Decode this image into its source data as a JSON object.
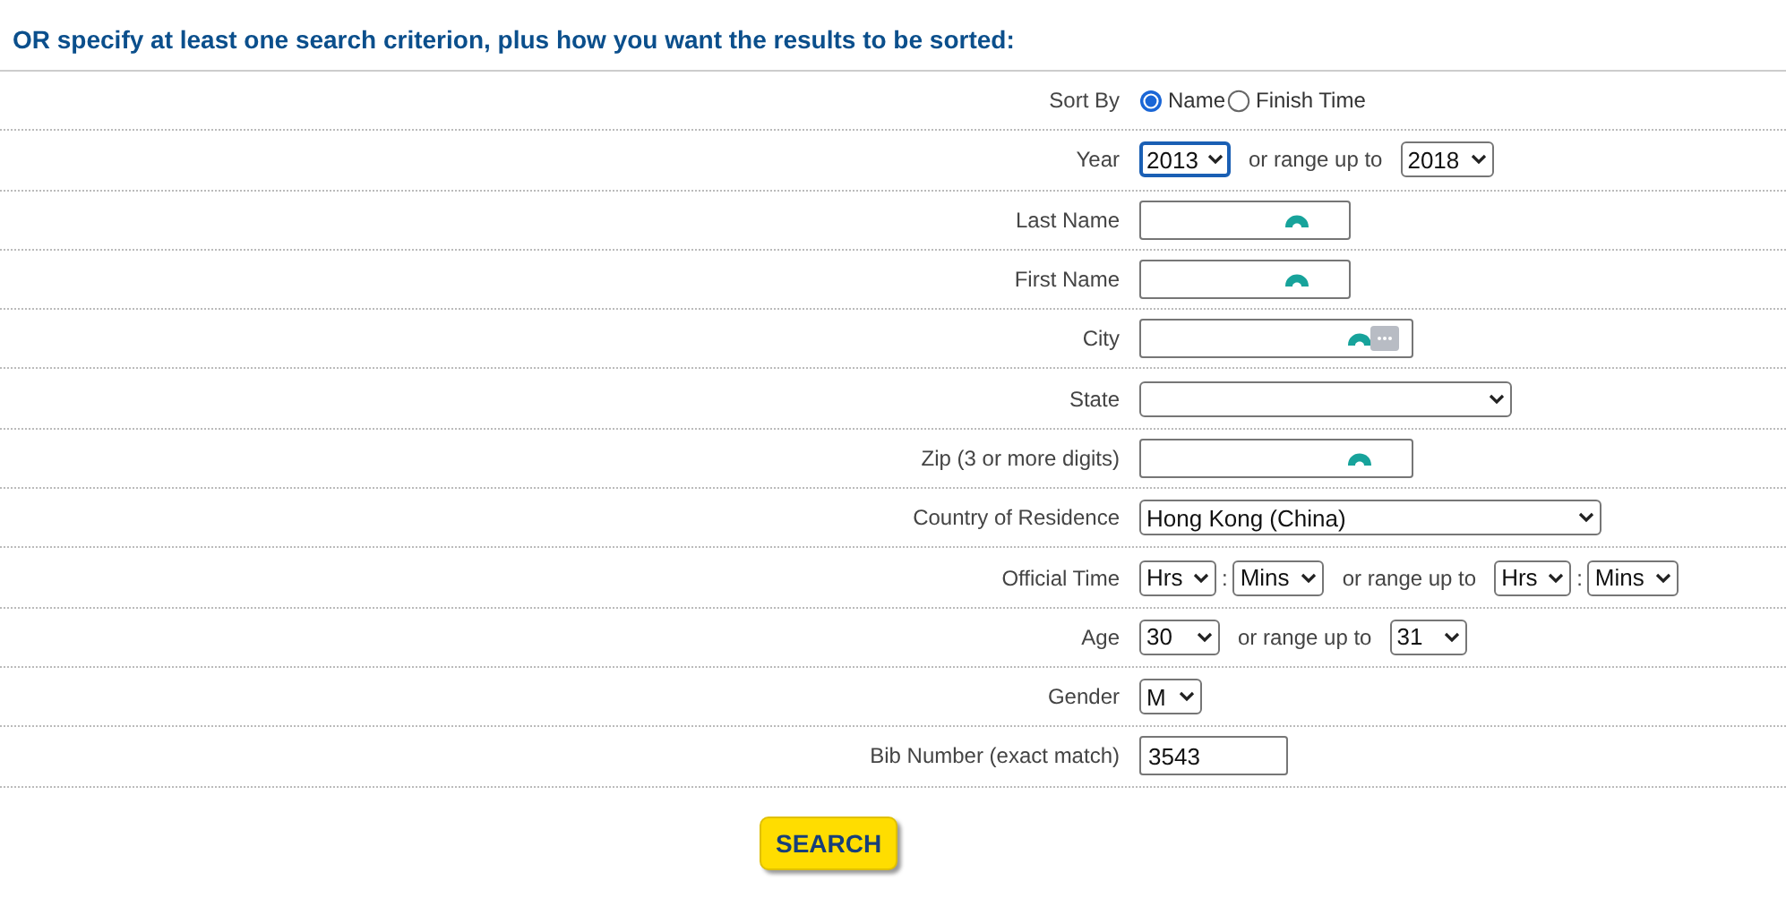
{
  "heading": "OR specify at least one search criterion, plus how you want the results to be sorted:",
  "rows": [
    {
      "kind": "radio",
      "label": "Sort By",
      "options": [
        {
          "label": "Name",
          "selected": true
        },
        {
          "label": "Finish Time",
          "selected": false
        }
      ]
    },
    {
      "kind": "range",
      "label": "Year",
      "from": {
        "value": "2013",
        "focused": true
      },
      "joiner": "or range up to",
      "to": {
        "value": "2018",
        "focused": false
      }
    },
    {
      "kind": "text",
      "label": "Last Name",
      "helper_icon": true,
      "menu_icon": false
    },
    {
      "kind": "text",
      "label": "First Name",
      "helper_icon": true,
      "menu_icon": false
    },
    {
      "kind": "text",
      "label": "City",
      "helper_icon": true,
      "menu_icon": true
    },
    {
      "kind": "select",
      "label": "State"
    },
    {
      "kind": "text",
      "label": "Zip (3 or more digits)",
      "helper_icon": true,
      "menu_icon": false
    },
    {
      "kind": "select",
      "label": "Country of Residence",
      "value": "Hong Kong (China)"
    },
    {
      "kind": "time",
      "label": "Official Time",
      "from": {
        "hours": "Hrs",
        "separator": ":",
        "minutes": "Mins"
      },
      "joiner": "or range up to",
      "to": {
        "hours": "Hrs",
        "separator": ":",
        "minutes": "Mins"
      }
    },
    {
      "kind": "range",
      "label": "Age",
      "from": {
        "value": "30",
        "focused": false
      },
      "joiner": "or range up to",
      "to": {
        "value": "31",
        "focused": false
      }
    },
    {
      "kind": "select",
      "label": "Gender",
      "value": "M"
    },
    {
      "kind": "text",
      "label": "Bib Number (exact match)",
      "value": "3543",
      "helper_icon": false,
      "menu_icon": false
    }
  ],
  "search_button": "SEARCH"
}
